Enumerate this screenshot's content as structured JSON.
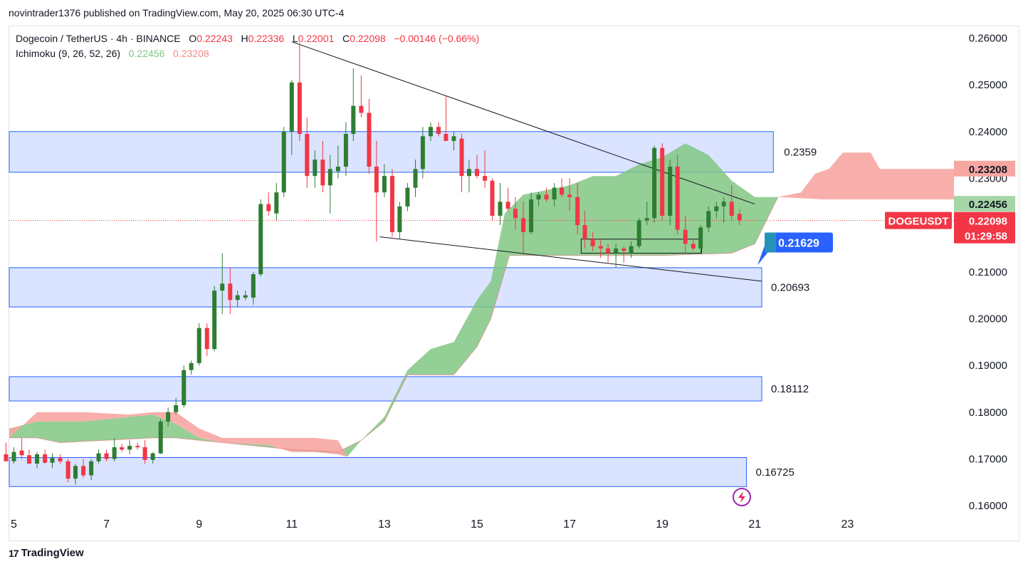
{
  "header": {
    "published_line": "novintrader1376 published on TradingView.com, May 20, 2025 06:30 UTC-4"
  },
  "legend": {
    "symbol_line": "Dogecoin / TetherUS · 4h · BINANCE",
    "o_label": "O",
    "o_value": "0.22243",
    "h_label": "H",
    "h_value": "0.22336",
    "l_label": "L",
    "l_value": "0.22001",
    "c_label": "C",
    "c_value": "0.22098",
    "change": "−0.00146 (−0.66%)",
    "indicator": "Ichimoku (9, 26, 52, 26)",
    "ind_value_a": "0.22456",
    "ind_value_b": "0.23208"
  },
  "colors": {
    "bull": "#2e7d32",
    "bear": "#f23645",
    "zone_fill": "#d6e0ff",
    "zone_stroke": "#2962ff",
    "cloud_bull": "#81c784",
    "cloud_bear": "#f7a6a2",
    "price_tag": "#f23645",
    "blue_tag": "#2962ff"
  },
  "footer": {
    "brand": "TradingView"
  },
  "chart_data": {
    "type": "candlestick",
    "timeframe": "4h",
    "x_tick_labels": [
      "5",
      "7",
      "9",
      "11",
      "13",
      "15",
      "17",
      "19",
      "21",
      "23"
    ],
    "x_tick_days": [
      5,
      7,
      9,
      11,
      13,
      15,
      17,
      19,
      21,
      23
    ],
    "y_tick_labels": [
      "0.26000",
      "0.25000",
      "0.24000",
      "0.23000",
      "0.22000",
      "0.21000",
      "0.20000",
      "0.19000",
      "0.18000",
      "0.17000",
      "0.16000"
    ],
    "ylim": [
      0.1585,
      0.2625
    ],
    "xlim": [
      4.9,
      25.3
    ],
    "grid": false,
    "candles": [
      {
        "t": 4.83,
        "o": 0.171,
        "h": 0.1735,
        "l": 0.17,
        "c": 0.1695
      },
      {
        "t": 5.0,
        "o": 0.1695,
        "h": 0.1725,
        "l": 0.169,
        "c": 0.1715
      },
      {
        "t": 5.17,
        "o": 0.1718,
        "h": 0.1745,
        "l": 0.17,
        "c": 0.1708
      },
      {
        "t": 5.33,
        "o": 0.1708,
        "h": 0.172,
        "l": 0.169,
        "c": 0.169
      },
      {
        "t": 5.5,
        "o": 0.169,
        "h": 0.1715,
        "l": 0.168,
        "c": 0.171
      },
      {
        "t": 5.67,
        "o": 0.171,
        "h": 0.172,
        "l": 0.169,
        "c": 0.1692
      },
      {
        "t": 5.83,
        "o": 0.1692,
        "h": 0.1712,
        "l": 0.168,
        "c": 0.1702
      },
      {
        "t": 6.0,
        "o": 0.1702,
        "h": 0.171,
        "l": 0.169,
        "c": 0.1695
      },
      {
        "t": 6.17,
        "o": 0.1695,
        "h": 0.17,
        "l": 0.165,
        "c": 0.1658
      },
      {
        "t": 6.33,
        "o": 0.1658,
        "h": 0.169,
        "l": 0.1645,
        "c": 0.1685
      },
      {
        "t": 6.5,
        "o": 0.1685,
        "h": 0.17,
        "l": 0.166,
        "c": 0.1665
      },
      {
        "t": 6.67,
        "o": 0.1665,
        "h": 0.17,
        "l": 0.1655,
        "c": 0.1695
      },
      {
        "t": 6.83,
        "o": 0.1695,
        "h": 0.172,
        "l": 0.169,
        "c": 0.1712
      },
      {
        "t": 7.0,
        "o": 0.1712,
        "h": 0.172,
        "l": 0.1695,
        "c": 0.17
      },
      {
        "t": 7.17,
        "o": 0.17,
        "h": 0.1745,
        "l": 0.1695,
        "c": 0.1725
      },
      {
        "t": 7.33,
        "o": 0.1725,
        "h": 0.1732,
        "l": 0.1715,
        "c": 0.172
      },
      {
        "t": 7.5,
        "o": 0.172,
        "h": 0.174,
        "l": 0.171,
        "c": 0.1728
      },
      {
        "t": 7.67,
        "o": 0.1728,
        "h": 0.1735,
        "l": 0.172,
        "c": 0.1725
      },
      {
        "t": 7.83,
        "o": 0.1725,
        "h": 0.174,
        "l": 0.169,
        "c": 0.1698
      },
      {
        "t": 8.0,
        "o": 0.1698,
        "h": 0.1715,
        "l": 0.169,
        "c": 0.1712
      },
      {
        "t": 8.17,
        "o": 0.1712,
        "h": 0.1785,
        "l": 0.171,
        "c": 0.178
      },
      {
        "t": 8.33,
        "o": 0.178,
        "h": 0.181,
        "l": 0.177,
        "c": 0.18
      },
      {
        "t": 8.5,
        "o": 0.18,
        "h": 0.183,
        "l": 0.1795,
        "c": 0.1815
      },
      {
        "t": 8.67,
        "o": 0.1815,
        "h": 0.19,
        "l": 0.181,
        "c": 0.189
      },
      {
        "t": 8.83,
        "o": 0.189,
        "h": 0.191,
        "l": 0.188,
        "c": 0.1905
      },
      {
        "t": 9.0,
        "o": 0.1905,
        "h": 0.199,
        "l": 0.19,
        "c": 0.198
      },
      {
        "t": 9.17,
        "o": 0.198,
        "h": 0.199,
        "l": 0.192,
        "c": 0.1935
      },
      {
        "t": 9.33,
        "o": 0.1935,
        "h": 0.207,
        "l": 0.193,
        "c": 0.206
      },
      {
        "t": 9.5,
        "o": 0.206,
        "h": 0.214,
        "l": 0.201,
        "c": 0.2075
      },
      {
        "t": 9.67,
        "o": 0.2075,
        "h": 0.211,
        "l": 0.201,
        "c": 0.204
      },
      {
        "t": 9.83,
        "o": 0.204,
        "h": 0.206,
        "l": 0.2025,
        "c": 0.205
      },
      {
        "t": 10.0,
        "o": 0.2045,
        "h": 0.206,
        "l": 0.204,
        "c": 0.205
      },
      {
        "t": 10.17,
        "o": 0.2045,
        "h": 0.21,
        "l": 0.203,
        "c": 0.2095
      },
      {
        "t": 10.33,
        "o": 0.2095,
        "h": 0.2255,
        "l": 0.209,
        "c": 0.2245
      },
      {
        "t": 10.5,
        "o": 0.2245,
        "h": 0.227,
        "l": 0.222,
        "c": 0.223
      },
      {
        "t": 10.67,
        "o": 0.2225,
        "h": 0.229,
        "l": 0.221,
        "c": 0.227
      },
      {
        "t": 10.83,
        "o": 0.227,
        "h": 0.241,
        "l": 0.226,
        "c": 0.24
      },
      {
        "t": 11.0,
        "o": 0.24,
        "h": 0.251,
        "l": 0.235,
        "c": 0.2505
      },
      {
        "t": 11.17,
        "o": 0.2505,
        "h": 0.259,
        "l": 0.238,
        "c": 0.2395
      },
      {
        "t": 11.33,
        "o": 0.2395,
        "h": 0.243,
        "l": 0.228,
        "c": 0.2305
      },
      {
        "t": 11.5,
        "o": 0.2305,
        "h": 0.236,
        "l": 0.228,
        "c": 0.234
      },
      {
        "t": 11.67,
        "o": 0.234,
        "h": 0.238,
        "l": 0.227,
        "c": 0.2285
      },
      {
        "t": 11.83,
        "o": 0.2285,
        "h": 0.235,
        "l": 0.2225,
        "c": 0.232
      },
      {
        "t": 12.0,
        "o": 0.2315,
        "h": 0.237,
        "l": 0.23,
        "c": 0.2325
      },
      {
        "t": 12.17,
        "o": 0.2325,
        "h": 0.242,
        "l": 0.2305,
        "c": 0.2395
      },
      {
        "t": 12.33,
        "o": 0.2395,
        "h": 0.2535,
        "l": 0.238,
        "c": 0.2455
      },
      {
        "t": 12.5,
        "o": 0.2455,
        "h": 0.252,
        "l": 0.243,
        "c": 0.244
      },
      {
        "t": 12.67,
        "o": 0.244,
        "h": 0.247,
        "l": 0.231,
        "c": 0.2325
      },
      {
        "t": 12.83,
        "o": 0.2325,
        "h": 0.238,
        "l": 0.2165,
        "c": 0.227
      },
      {
        "t": 13.0,
        "o": 0.227,
        "h": 0.233,
        "l": 0.226,
        "c": 0.2305
      },
      {
        "t": 13.17,
        "o": 0.2305,
        "h": 0.232,
        "l": 0.2175,
        "c": 0.2185
      },
      {
        "t": 13.33,
        "o": 0.2185,
        "h": 0.225,
        "l": 0.217,
        "c": 0.224
      },
      {
        "t": 13.5,
        "o": 0.224,
        "h": 0.229,
        "l": 0.223,
        "c": 0.228
      },
      {
        "t": 13.67,
        "o": 0.228,
        "h": 0.234,
        "l": 0.226,
        "c": 0.232
      },
      {
        "t": 13.83,
        "o": 0.232,
        "h": 0.241,
        "l": 0.23,
        "c": 0.239
      },
      {
        "t": 14.0,
        "o": 0.239,
        "h": 0.242,
        "l": 0.238,
        "c": 0.241
      },
      {
        "t": 14.17,
        "o": 0.241,
        "h": 0.242,
        "l": 0.239,
        "c": 0.2395
      },
      {
        "t": 14.33,
        "o": 0.2395,
        "h": 0.2475,
        "l": 0.238,
        "c": 0.238
      },
      {
        "t": 14.5,
        "o": 0.238,
        "h": 0.24,
        "l": 0.236,
        "c": 0.239
      },
      {
        "t": 14.67,
        "o": 0.2385,
        "h": 0.2395,
        "l": 0.227,
        "c": 0.2305
      },
      {
        "t": 14.83,
        "o": 0.2305,
        "h": 0.234,
        "l": 0.227,
        "c": 0.232
      },
      {
        "t": 15.0,
        "o": 0.232,
        "h": 0.235,
        "l": 0.23,
        "c": 0.2305
      },
      {
        "t": 15.17,
        "o": 0.2305,
        "h": 0.236,
        "l": 0.228,
        "c": 0.2295
      },
      {
        "t": 15.33,
        "o": 0.2295,
        "h": 0.23,
        "l": 0.221,
        "c": 0.222
      },
      {
        "t": 15.5,
        "o": 0.222,
        "h": 0.229,
        "l": 0.22,
        "c": 0.225
      },
      {
        "t": 15.67,
        "o": 0.225,
        "h": 0.228,
        "l": 0.223,
        "c": 0.2235
      },
      {
        "t": 15.83,
        "o": 0.2235,
        "h": 0.226,
        "l": 0.219,
        "c": 0.2215
      },
      {
        "t": 16.0,
        "o": 0.2215,
        "h": 0.225,
        "l": 0.214,
        "c": 0.2185
      },
      {
        "t": 16.17,
        "o": 0.2185,
        "h": 0.227,
        "l": 0.218,
        "c": 0.2255
      },
      {
        "t": 16.33,
        "o": 0.2255,
        "h": 0.227,
        "l": 0.224,
        "c": 0.2265
      },
      {
        "t": 16.5,
        "o": 0.2265,
        "h": 0.228,
        "l": 0.225,
        "c": 0.2255
      },
      {
        "t": 16.67,
        "o": 0.2255,
        "h": 0.229,
        "l": 0.224,
        "c": 0.228
      },
      {
        "t": 16.83,
        "o": 0.228,
        "h": 0.23,
        "l": 0.226,
        "c": 0.2265
      },
      {
        "t": 17.0,
        "o": 0.2265,
        "h": 0.23,
        "l": 0.223,
        "c": 0.226
      },
      {
        "t": 17.17,
        "o": 0.226,
        "h": 0.229,
        "l": 0.218,
        "c": 0.22
      },
      {
        "t": 17.33,
        "o": 0.22,
        "h": 0.223,
        "l": 0.215,
        "c": 0.217
      },
      {
        "t": 17.5,
        "o": 0.217,
        "h": 0.2185,
        "l": 0.2145,
        "c": 0.2155
      },
      {
        "t": 17.67,
        "o": 0.2155,
        "h": 0.217,
        "l": 0.213,
        "c": 0.215
      },
      {
        "t": 17.83,
        "o": 0.215,
        "h": 0.216,
        "l": 0.212,
        "c": 0.214
      },
      {
        "t": 18.0,
        "o": 0.214,
        "h": 0.216,
        "l": 0.211,
        "c": 0.215
      },
      {
        "t": 18.17,
        "o": 0.215,
        "h": 0.2155,
        "l": 0.212,
        "c": 0.2145
      },
      {
        "t": 18.33,
        "o": 0.214,
        "h": 0.2165,
        "l": 0.213,
        "c": 0.2155
      },
      {
        "t": 18.5,
        "o": 0.2155,
        "h": 0.2215,
        "l": 0.215,
        "c": 0.221
      },
      {
        "t": 18.67,
        "o": 0.221,
        "h": 0.225,
        "l": 0.22,
        "c": 0.2215
      },
      {
        "t": 18.83,
        "o": 0.2215,
        "h": 0.237,
        "l": 0.2205,
        "c": 0.2365
      },
      {
        "t": 19.0,
        "o": 0.2365,
        "h": 0.2375,
        "l": 0.221,
        "c": 0.222
      },
      {
        "t": 19.17,
        "o": 0.222,
        "h": 0.234,
        "l": 0.22,
        "c": 0.2325
      },
      {
        "t": 19.33,
        "o": 0.2325,
        "h": 0.235,
        "l": 0.218,
        "c": 0.219
      },
      {
        "t": 19.5,
        "o": 0.219,
        "h": 0.222,
        "l": 0.214,
        "c": 0.216
      },
      {
        "t": 19.67,
        "o": 0.216,
        "h": 0.217,
        "l": 0.2145,
        "c": 0.215
      },
      {
        "t": 19.83,
        "o": 0.215,
        "h": 0.22,
        "l": 0.214,
        "c": 0.2195
      },
      {
        "t": 20.0,
        "o": 0.2195,
        "h": 0.224,
        "l": 0.2185,
        "c": 0.223
      },
      {
        "t": 20.17,
        "o": 0.223,
        "h": 0.225,
        "l": 0.2215,
        "c": 0.224
      },
      {
        "t": 20.33,
        "o": 0.224,
        "h": 0.226,
        "l": 0.2205,
        "c": 0.225
      },
      {
        "t": 20.5,
        "o": 0.225,
        "h": 0.2285,
        "l": 0.221,
        "c": 0.222
      },
      {
        "t": 20.67,
        "o": 0.2224,
        "h": 0.2234,
        "l": 0.22,
        "c": 0.221
      }
    ],
    "cloud": {
      "span_a": [
        [
          4.9,
          0.1765
        ],
        [
          5.5,
          0.178
        ],
        [
          6.5,
          0.178
        ],
        [
          7.5,
          0.179
        ],
        [
          8.0,
          0.1795
        ],
        [
          8.5,
          0.1775
        ],
        [
          9.0,
          0.1745
        ],
        [
          9.5,
          0.1735
        ],
        [
          10.5,
          0.173
        ],
        [
          11.0,
          0.1715
        ],
        [
          11.5,
          0.1715
        ],
        [
          12.0,
          0.171
        ],
        [
          12.2,
          0.1705
        ],
        [
          12.5,
          0.174
        ],
        [
          13.0,
          0.179
        ],
        [
          13.5,
          0.189
        ],
        [
          14.0,
          0.1935
        ],
        [
          14.5,
          0.195
        ],
        [
          15.0,
          0.204
        ],
        [
          15.3,
          0.208
        ],
        [
          15.6,
          0.2225
        ],
        [
          16.0,
          0.2265
        ],
        [
          16.5,
          0.2275
        ],
        [
          17.0,
          0.2285
        ],
        [
          17.5,
          0.2305
        ],
        [
          18.0,
          0.2305
        ],
        [
          18.5,
          0.233
        ],
        [
          19.0,
          0.2345
        ],
        [
          19.5,
          0.2375
        ],
        [
          20.0,
          0.235
        ],
        [
          20.5,
          0.2295
        ],
        [
          21.0,
          0.226
        ],
        [
          21.5,
          0.226
        ]
      ],
      "span_b": [
        [
          4.9,
          0.1745
        ],
        [
          5.5,
          0.1745
        ],
        [
          6.0,
          0.1735
        ],
        [
          7.0,
          0.174
        ],
        [
          8.0,
          0.1745
        ],
        [
          8.5,
          0.1745
        ],
        [
          9.0,
          0.174
        ],
        [
          10.0,
          0.173
        ],
        [
          11.0,
          0.172
        ],
        [
          12.0,
          0.1715
        ],
        [
          12.5,
          0.174
        ],
        [
          13.0,
          0.178
        ],
        [
          13.5,
          0.188
        ],
        [
          14.5,
          0.188
        ],
        [
          15.0,
          0.194
        ],
        [
          15.3,
          0.2
        ],
        [
          15.7,
          0.2135
        ],
        [
          16.0,
          0.2135
        ],
        [
          18.0,
          0.2135
        ],
        [
          19.0,
          0.2135
        ],
        [
          20.5,
          0.214
        ],
        [
          21.0,
          0.216
        ],
        [
          21.5,
          0.226
        ]
      ],
      "future_top": [
        [
          21.5,
          0.226
        ],
        [
          22.0,
          0.227
        ],
        [
          22.3,
          0.231
        ],
        [
          22.6,
          0.232
        ],
        [
          22.9,
          0.2355
        ],
        [
          23.5,
          0.2355
        ],
        [
          23.7,
          0.232
        ],
        [
          24.5,
          0.232
        ],
        [
          25.3,
          0.232
        ]
      ],
      "future_bottom": [
        [
          21.5,
          0.226
        ],
        [
          22.5,
          0.2255
        ],
        [
          24.0,
          0.2255
        ],
        [
          25.3,
          0.2255
        ]
      ]
    },
    "zones": [
      {
        "top": 0.24,
        "bottom": 0.2313,
        "x_end": 21.4,
        "label": "0.2359"
      },
      {
        "top": 0.2109,
        "bottom": 0.2025,
        "x_end": 21.15,
        "label": "0.20693"
      },
      {
        "top": 0.1876,
        "bottom": 0.1824,
        "x_end": 21.15,
        "label": "0.18112"
      },
      {
        "top": 0.1703,
        "bottom": 0.1641,
        "x_end": 20.82,
        "label": "0.16725"
      }
    ],
    "trendlines": [
      {
        "x1": 11.0,
        "y1": 0.2592,
        "x2": 21.0,
        "y2": 0.2245
      },
      {
        "x1": 12.9,
        "y1": 0.2175,
        "x2": 21.15,
        "y2": 0.208
      }
    ],
    "small_box": {
      "x1": 17.25,
      "y1": 0.217,
      "x2": 19.85,
      "y2": 0.214
    },
    "current_price": 0.22098,
    "price_labels": {
      "ichi_b_tag": "0.23208",
      "ichi_b_value": 0.23208,
      "ichi_a_tag": "0.22456",
      "ichi_a_value": 0.22456,
      "symbol_tag": "DOGEUSDT",
      "price_tag": "0.22098",
      "countdown": "01:29:58",
      "blue_tag": "0.21629",
      "blue_value": 0.21629
    }
  }
}
